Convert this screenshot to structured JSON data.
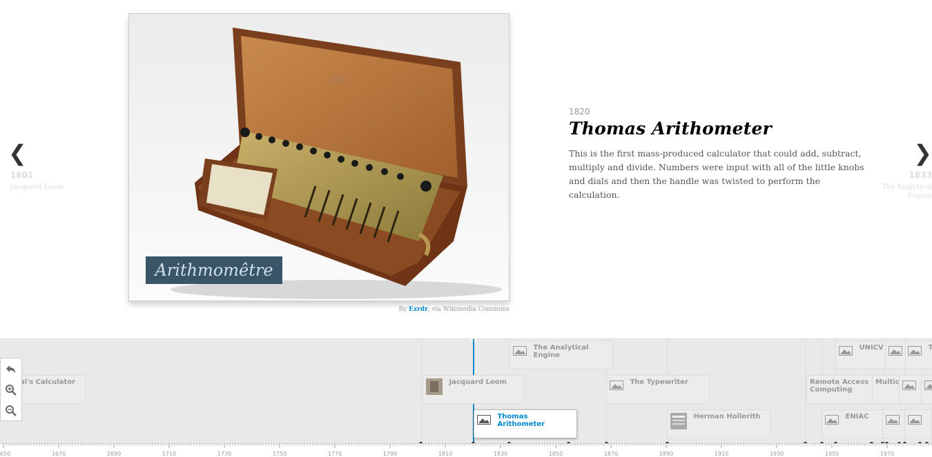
{
  "slide": {
    "prev": {
      "arrow": "❮",
      "date": "1801",
      "title": "Jacquard Loom"
    },
    "next": {
      "arrow": "❯",
      "date": "1833",
      "title": "The Analytical Engine"
    },
    "image": {
      "plaque_text": "Arithmomêtre"
    },
    "credit": {
      "prefix": "By",
      "author": "Ezrdr",
      "suffix": ", via Wikimedia Commons"
    },
    "date": "1820",
    "title": "Thomas Arithometer",
    "body": "This is the first mass-produced calculator that could add, subtract, multiply and divide. Numbers were input with all of the little knobs and dials and then the handle was twisted to perform the calculation."
  },
  "timeline": {
    "flags": [
      {
        "label": "al's Calculator",
        "icon": "none"
      },
      {
        "label": "Jacquard Loom",
        "icon": "photo-thumbnail-icon"
      },
      {
        "label": "The Analytical Engine",
        "icon": "image-icon"
      },
      {
        "label": "Thomas Arithometer",
        "icon": "image-icon",
        "active": true
      },
      {
        "label": "The Typewriter",
        "icon": "image-icon"
      },
      {
        "label": "Herman Hollerith",
        "icon": "document-thumbnail-icon"
      },
      {
        "label": "Remote Access Computing",
        "icon": "none"
      },
      {
        "label": "Multic",
        "icon": "none"
      },
      {
        "label": "UNICV",
        "icon": "image-icon"
      },
      {
        "label": "ENIAC",
        "icon": "image-icon"
      },
      {
        "label": "T",
        "icon": "image-icon"
      }
    ],
    "tools": [
      {
        "name": "back-to-start",
        "icon": "undo-arrow-icon"
      },
      {
        "name": "zoom-in",
        "icon": "zoom-in-icon"
      },
      {
        "name": "zoom-out",
        "icon": "zoom-out-icon"
      }
    ],
    "years": [
      "1650",
      "1670",
      "1690",
      "1710",
      "1730",
      "1750",
      "1770",
      "1790",
      "1810",
      "1830",
      "1850",
      "1870",
      "1890",
      "1910",
      "1930",
      "1950",
      "1970"
    ]
  }
}
